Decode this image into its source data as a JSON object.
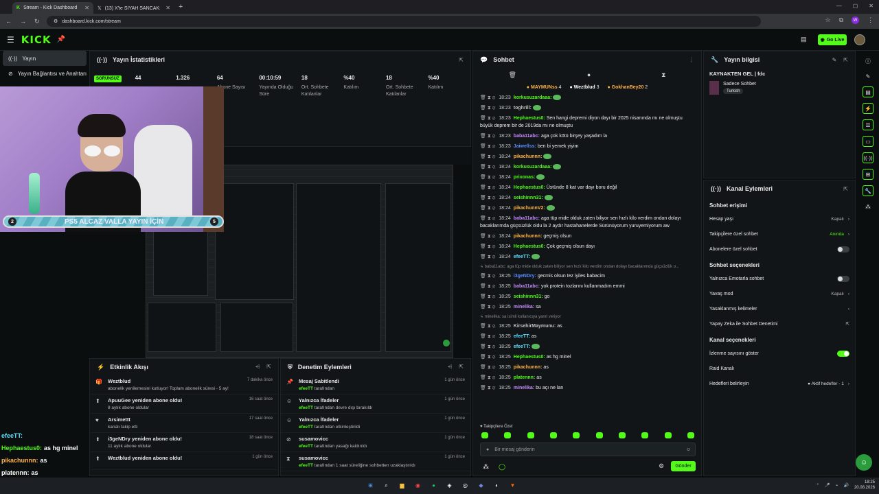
{
  "browser": {
    "tabs": [
      {
        "title": "Stream - Kick Dashboard",
        "active": true
      },
      {
        "title": "(13) X'te SİYAH SANCAK: 🔵 Y",
        "active": false
      }
    ],
    "url": "dashboard.kick.com/stream",
    "profile_letter": "W"
  },
  "header": {
    "logo": "KICK",
    "golive_label": "Go Live"
  },
  "nav": {
    "items": [
      {
        "label": "Yayın",
        "icon": "broadcast-icon"
      },
      {
        "label": "Yayın Bağlantısı ve Anahtarı",
        "icon": "link-icon"
      }
    ]
  },
  "stats": {
    "title": "Yayın İstatistikleri",
    "status_badge": "SORUNSUZ",
    "items": [
      {
        "value": "44",
        "label": ""
      },
      {
        "value": "1.326",
        "label": ""
      },
      {
        "value": "64",
        "label": "Abone Sayısı"
      },
      {
        "value": "00:10:59",
        "label": "Yayında Olduğu Süre"
      },
      {
        "value": "18",
        "label": "Ort. Sohbete Katılanlar"
      },
      {
        "value": "%40",
        "label": "Katılım"
      },
      {
        "value": "18",
        "label": "Ort. Sohbete Katılanlar"
      },
      {
        "value": "%40",
        "label": "Katılım"
      }
    ]
  },
  "overlay": {
    "goal_text": "PS5 ALCAZ VALLA YAYIN İÇİN",
    "goal_current": "2",
    "goal_target": "5",
    "goal_progress": 0.4,
    "chat": [
      {
        "user": "efeeTT:",
        "msg": "",
        "color": "cy"
      },
      {
        "user": "Hephaestus0:",
        "msg": "as hg minel",
        "color": "g"
      },
      {
        "user": "pikachunnn:",
        "msg": "as",
        "color": "o"
      },
      {
        "user": "platennn:",
        "msg": "as",
        "color": "w"
      },
      {
        "user": "minelika:",
        "msg": "bu açı ne lan",
        "color": "pu"
      }
    ]
  },
  "activity": {
    "title": "Etkinlik Akışı",
    "items": [
      {
        "icon": "gift-icon",
        "title": "Weztblud",
        "sub": "abonelik yenilemesini kutluyor! Toplam abonelik süresi - 5 ay!",
        "time": "7 dakika önce"
      },
      {
        "icon": "star-icon",
        "title": "ApuuGee yeniden abone oldu!",
        "sub": "8 aylık abone oldular",
        "time": "16 saat önce"
      },
      {
        "icon": "heart-icon",
        "title": "Arsimettt",
        "sub": "kanalı takip etti",
        "time": "17 saat önce"
      },
      {
        "icon": "star-icon",
        "title": "i3geNDry yeniden abone oldu!",
        "sub": "11 aylık abone oldular",
        "time": "18 saat önce"
      },
      {
        "icon": "star-icon",
        "title": "Weztblud yeniden abone oldu!",
        "sub": "",
        "time": "1 gün önce"
      }
    ]
  },
  "moderation": {
    "title": "Denetim Eylemleri",
    "items": [
      {
        "icon": "pin-icon",
        "title": "Mesaj Sabitlendi",
        "user": "efeeTT",
        "sub": "tarafından",
        "time": "1 gün önce"
      },
      {
        "icon": "smile-icon",
        "title": "Yalnızca İfadeler",
        "user": "efeeTT",
        "sub": "tarafından devre dışı bırakıldı",
        "time": "1 gün önce"
      },
      {
        "icon": "smile-icon",
        "title": "Yalnızca İfadeler",
        "user": "efeeTT",
        "sub": "tarafından etkinleştirildi",
        "time": "1 gün önce"
      },
      {
        "icon": "ban-icon",
        "title": "susamovicc",
        "user": "efeeTT",
        "sub": "tarafından yasağı kaldırıldı",
        "time": "1 gün önce"
      },
      {
        "icon": "timeout-icon",
        "title": "susamovicc",
        "user": "efeeTT",
        "sub": "tarafından 1 saat süreliğine sohbetten uzaklaştırıldı",
        "time": "1 gün önce"
      }
    ]
  },
  "chat": {
    "title": "Sohbet",
    "top_gifters": [
      {
        "name": "MAYMUNss",
        "count": "4"
      },
      {
        "name": "Weztblud",
        "count": "3"
      },
      {
        "name": "GokhanBey20",
        "count": "2"
      }
    ],
    "messages": [
      {
        "time": "18:23",
        "user": "korkusuzardaaa:",
        "color": "#53fc18",
        "text": ""
      },
      {
        "time": "18:23",
        "user": "toghrill:",
        "color": "#c0c0c0",
        "text": ""
      },
      {
        "time": "18:23",
        "user": "Hephaestus0:",
        "color": "#53fc18",
        "text": "Sen hangi depremi diyon dayı bir 2025 nisanında mı ne olmuştu büyük deprem bir de 2019da mı ne olmuştu"
      },
      {
        "time": "18:23",
        "user": "baba11abc:",
        "color": "#c68bff",
        "text": "aga çok kötü birşey yaşadım la"
      },
      {
        "time": "18:23",
        "user": "Jaiwellss:",
        "color": "#5b8cff",
        "text": "ben bi yemek yiyim"
      },
      {
        "time": "18:24",
        "user": "pikachunnn:",
        "color": "#ffb347",
        "text": ""
      },
      {
        "time": "18:24",
        "user": "korkusuzardaaa:",
        "color": "#53fc18",
        "text": ""
      },
      {
        "time": "18:24",
        "user": "prixonas:",
        "color": "#53fc18",
        "text": ""
      },
      {
        "time": "18:24",
        "user": "Hephaestus0:",
        "color": "#53fc18",
        "text": "Üstünde 8 kat var dayı boru değil"
      },
      {
        "time": "18:24",
        "user": "seishinnn31:",
        "color": "#53fc18",
        "text": ""
      },
      {
        "time": "18:24",
        "user": "pikachunnV2:",
        "color": "#ffb347",
        "text": ""
      },
      {
        "time": "18:24",
        "user": "baba11abc:",
        "color": "#c68bff",
        "text": "aga tüp mide olduk zaten biliyor sen hızlı kilo verdim ondan dolayı bacaklarımda güçsüzlük oldu la 2 aydır hastahanelerde Sürünüyorum yuruyemiyorum aw"
      },
      {
        "time": "18:24",
        "user": "pikachunnn:",
        "color": "#ffb347",
        "text": "geçmiş olsun"
      },
      {
        "time": "18:24",
        "user": "Hephaestus0:",
        "color": "#53fc18",
        "text": "Çok geçmiş olsun dayı"
      },
      {
        "time": "18:24",
        "user": "efeeTT:",
        "color": "#5ee0ff",
        "text": ""
      },
      {
        "reply": "baba11abc: aga tüp mide olduk zaten biliyor sen hızlı kilo verdim ondan dolayı bacaklarımda güçsüzlük o..."
      },
      {
        "time": "18:25",
        "user": "i3geNDry:",
        "color": "#5b8cff",
        "text": "gecmis olsun tez iyiles babacim"
      },
      {
        "time": "18:25",
        "user": "baba11abc:",
        "color": "#c68bff",
        "text": "yok protein tozlarını kullanmadım emmi"
      },
      {
        "time": "18:25",
        "user": "seishinnn31:",
        "color": "#53fc18",
        "text": "go"
      },
      {
        "time": "18:25",
        "user": "minelika:",
        "color": "#c68bff",
        "text": "sa"
      },
      {
        "reply": "minelika: sa isimli kullanıcıya yanıt veriyor"
      },
      {
        "time": "18:25",
        "user": "KirsehirMaymunu:",
        "color": "#c0c0c0",
        "text": "as"
      },
      {
        "time": "18:25",
        "user": "efeeTT:",
        "color": "#5ee0ff",
        "text": "as"
      },
      {
        "time": "18:25",
        "user": "efeeTT:",
        "color": "#5ee0ff",
        "text": ""
      },
      {
        "time": "18:25",
        "user": "Hephaestus0:",
        "color": "#53fc18",
        "text": "as hg minel"
      },
      {
        "time": "18:25",
        "user": "pikachunnn:",
        "color": "#ffb347",
        "text": "as"
      },
      {
        "time": "18:25",
        "user": "platennn:",
        "color": "#53fc18",
        "text": "as"
      },
      {
        "time": "18:25",
        "user": "minelika:",
        "color": "#c68bff",
        "text": "bu açı ne lan"
      }
    ],
    "followers_only": "Takipçilere Özel",
    "input_placeholder": "Bir mesaj gönderin",
    "send_label": "Gönder"
  },
  "info": {
    "title": "Yayın bilgisi",
    "stream_title": "KAYNAKTEN GEL | fdc",
    "category": "Sadece Sohbet",
    "tag": "Turkish"
  },
  "channel": {
    "title": "Kanal Eylemleri",
    "sections": [
      {
        "title": "Sohbet erişimi",
        "rows": [
          {
            "label": "Hesap yaşı",
            "value": "Kapalı",
            "type": "chevron"
          },
          {
            "label": "Takipçilere özel sohbet",
            "value": "Anında",
            "type": "chevron-green"
          },
          {
            "label": "Abonelere özel sohbet",
            "value": "",
            "type": "toggle-off"
          }
        ]
      },
      {
        "title": "Sohbet seçenekleri",
        "rows": [
          {
            "label": "Yalnızca Emotarla sohbet",
            "value": "",
            "type": "toggle-off"
          },
          {
            "label": "Yavaş mod",
            "value": "Kapalı",
            "type": "chevron"
          },
          {
            "label": "Yasaklanmış kelimeler",
            "value": "",
            "type": "chevron"
          },
          {
            "label": "Yapay Zeka ile Sohbet Denetimi",
            "value": "",
            "type": "external"
          }
        ]
      },
      {
        "title": "Kanal seçenekleri",
        "rows": [
          {
            "label": "İzlenme sayısını göster",
            "value": "",
            "type": "toggle-on"
          },
          {
            "label": "Raid Kanalı",
            "value": "",
            "type": "none"
          },
          {
            "label": "Hedefleri belirleyin",
            "value": "Aktif hedefler - 1",
            "type": "chevron-dot"
          }
        ]
      }
    ]
  },
  "taskbar": {
    "time": "18:25",
    "date": "20.08.2026"
  },
  "colors": {
    "accent": "#53fc18",
    "bg": "#0b0e0f",
    "panel": "#121517"
  }
}
